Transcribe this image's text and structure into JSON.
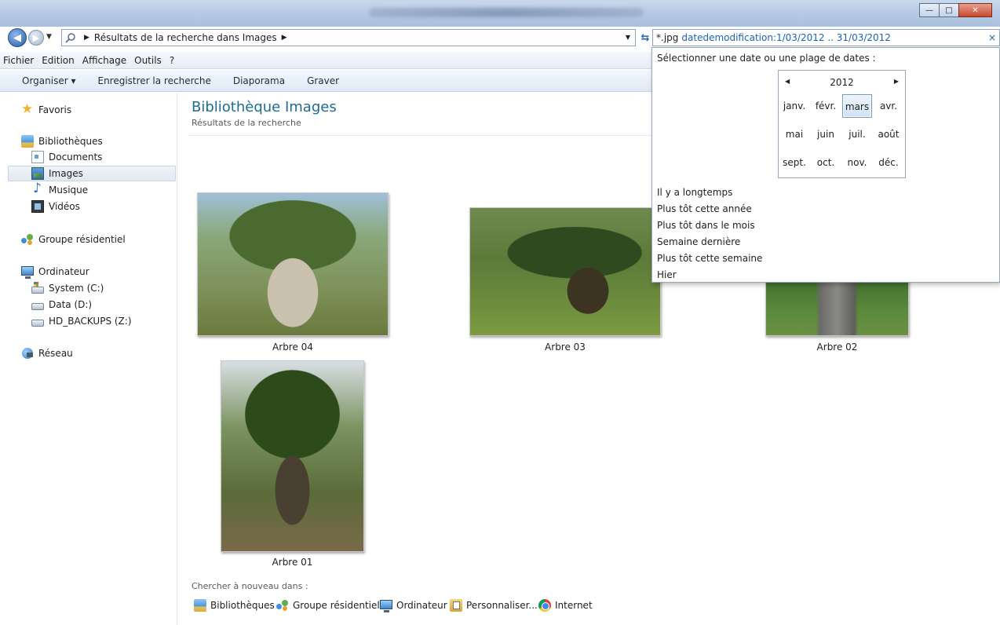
{
  "address": {
    "crumb": "Résultats de la recherche dans Images"
  },
  "search": {
    "keyword": "*.jpg",
    "filter": "datedemodification:1/03/2012 .. 31/03/2012",
    "clear_glyph": "×"
  },
  "menubar": {
    "items": [
      "Fichier",
      "Edition",
      "Affichage",
      "Outils",
      "?"
    ]
  },
  "toolbar": {
    "organize": "Organiser ▾",
    "save_search": "Enregistrer la recherche",
    "slideshow": "Diaporama",
    "burn": "Graver"
  },
  "sidebar": {
    "favorites": "Favoris",
    "libraries": "Bibliothèques",
    "documents": "Documents",
    "images": "Images",
    "music": "Musique",
    "videos": "Vidéos",
    "homegroup": "Groupe résidentiel",
    "computer": "Ordinateur",
    "drive_c": "System (C:)",
    "drive_d": "Data (D:)",
    "drive_z": "HD_BACKUPS (Z:)",
    "network": "Réseau"
  },
  "content": {
    "title": "Bibliothèque Images",
    "subtitle": "Résultats de la recherche",
    "items": [
      {
        "caption": "Arbre 04"
      },
      {
        "caption": "Arbre 03"
      },
      {
        "caption": "Arbre 02"
      },
      {
        "caption": "Arbre 01"
      }
    ],
    "search_again_label": "Chercher à nouveau dans :",
    "search_again": [
      "Bibliothèques",
      "Groupe résidentiel",
      "Ordinateur",
      "Personnaliser...",
      "Internet"
    ]
  },
  "date_popup": {
    "title": "Sélectionner une date ou une plage de dates :",
    "year": "2012",
    "months": [
      "janv.",
      "févr.",
      "mars",
      "avr.",
      "mai",
      "juin",
      "juil.",
      "août",
      "sept.",
      "oct.",
      "nov.",
      "déc."
    ],
    "selected_month": "mars",
    "presets": [
      "Il y a longtemps",
      "Plus tôt cette année",
      "Plus tôt dans le mois",
      "Semaine dernière",
      "Plus tôt cette semaine",
      "Hier"
    ]
  },
  "colors": {
    "library_title": "#1e6c8f",
    "search_filter": "#1c63ad",
    "titlebar": "#b7cbe4"
  }
}
